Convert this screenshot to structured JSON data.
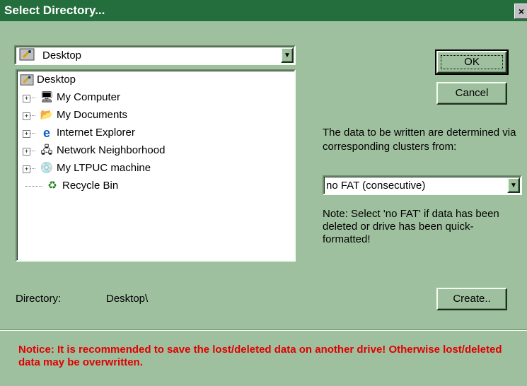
{
  "window": {
    "title": "Select Directory...",
    "close_glyph": "×"
  },
  "drive_combo": {
    "selected": "Desktop",
    "icon": "desktop-icon",
    "arrow": "▼"
  },
  "tree": {
    "root": {
      "label": "Desktop",
      "icon": "desktop-icon"
    },
    "items": [
      {
        "label": "My Computer",
        "icon": "computer-icon",
        "expander": "+"
      },
      {
        "label": "My Documents",
        "icon": "folder-icon",
        "expander": "+"
      },
      {
        "label": "Internet Explorer",
        "icon": "internet-explorer-icon",
        "expander": "+"
      },
      {
        "label": "Network Neighborhood",
        "icon": "network-icon",
        "expander": "+"
      },
      {
        "label": "My LTPUC machine",
        "icon": "machine-icon",
        "expander": "+"
      },
      {
        "label": "Recycle Bin",
        "icon": "recycle-bin-icon",
        "expander": ""
      }
    ]
  },
  "buttons": {
    "ok": "OK",
    "cancel": "Cancel",
    "create": "Create.."
  },
  "fat_info": {
    "description": "The data to be written are determined via corresponding clusters from:",
    "selected": "no FAT (consecutive)",
    "note": "Note: Select 'no FAT' if data has been deleted or drive has been quick-formatted!"
  },
  "directory": {
    "label": "Directory:",
    "value": "Desktop\\"
  },
  "notice": "Notice: It is recommended to save the lost/deleted data on another drive! Otherwise lost/deleted data may be overwritten.",
  "colors": {
    "background": "#9fc09f",
    "titlebar": "#246e3e",
    "notice": "#e00000"
  }
}
